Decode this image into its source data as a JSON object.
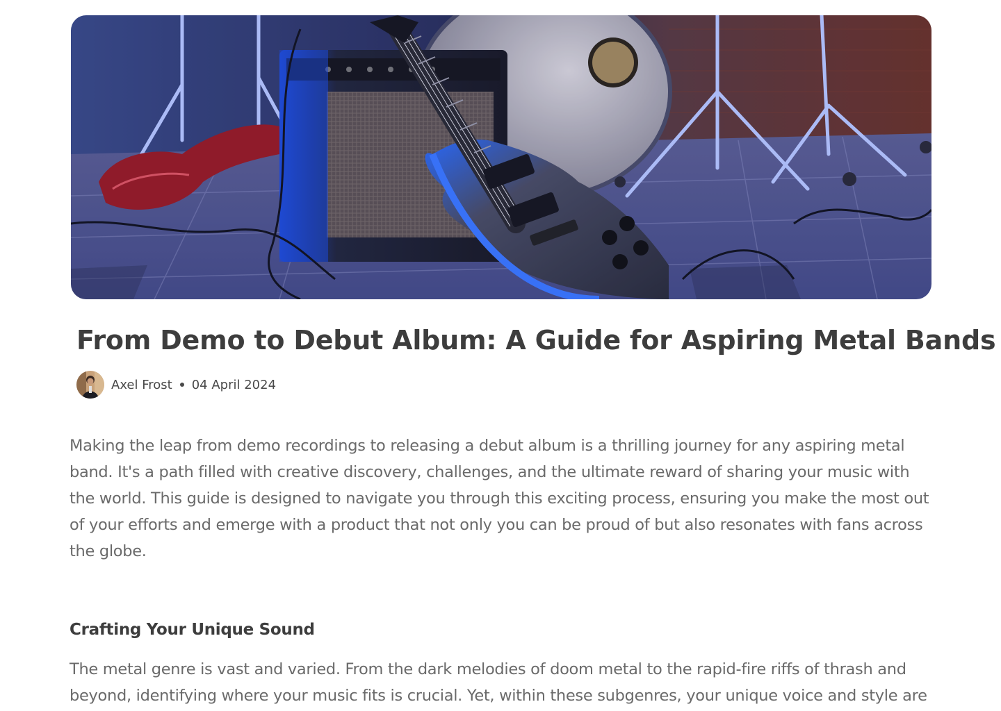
{
  "hero": {
    "image_subject": "electric guitar leaning on amplifier in front of drum kit under blue stage light"
  },
  "article": {
    "title": "From Demo to Debut Album: A Guide for Aspiring Metal Bands",
    "author": "Axel Frost",
    "date": "04 April 2024",
    "intro": "Making the leap from demo recordings to releasing a debut album is a thrilling journey for any aspiring metal band. It's a path filled with creative discovery, challenges, and the ultimate reward of sharing your music with the world. This guide is designed to navigate you through this exciting process, ensuring you make the most out of your efforts and emerge with a product that not only you can be proud of but also resonates with fans across the globe.",
    "section_heading": "Crafting Your Unique Sound",
    "section_text": "The metal genre is vast and varied. From the dark melodies of doom metal to the rapid-fire riffs of thrash and beyond, identifying where your music fits is crucial. Yet, within these subgenres, your unique voice and style are"
  },
  "colors": {
    "title": "#3d3d3d",
    "body_text": "#6a6a6a",
    "meta_text": "#4a4a4a",
    "stage_blue": "#2f5fd8"
  },
  "icons": {
    "author_avatar": "avatar-photo"
  }
}
